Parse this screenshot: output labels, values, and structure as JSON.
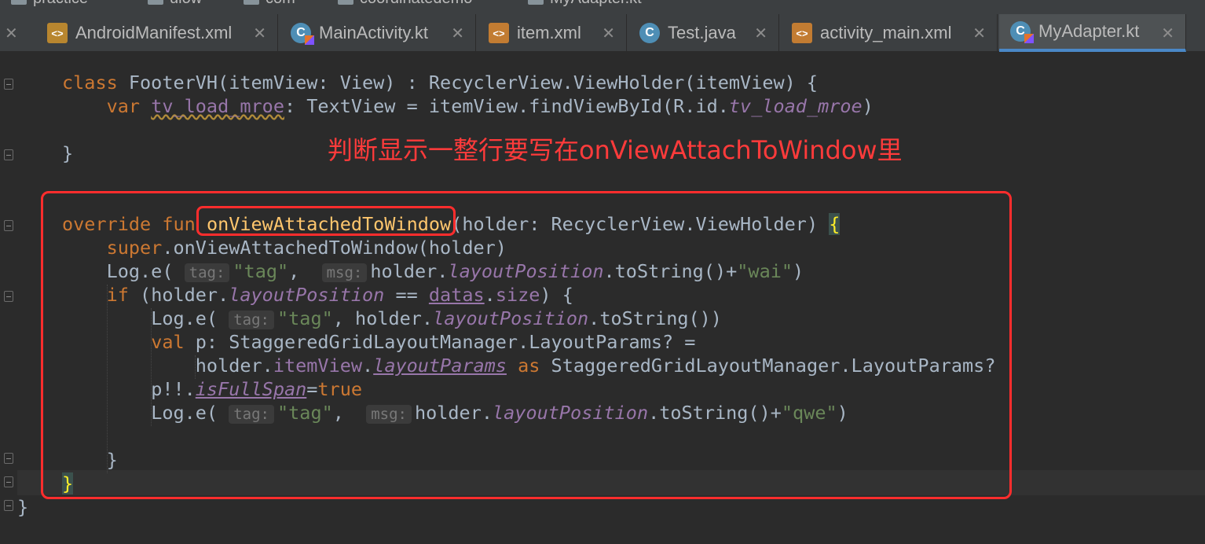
{
  "breadcrumbs": [
    "practice",
    "ulow",
    "com",
    "coordinatedemo",
    "MyAdapter.kt"
  ],
  "tabs": [
    {
      "label": "AndroidManifest.xml",
      "icon": "xml-manifest-icon"
    },
    {
      "label": "MainActivity.kt",
      "icon": "kotlin-class-icon"
    },
    {
      "label": "item.xml",
      "icon": "xml-layout-icon"
    },
    {
      "label": "Test.java",
      "icon": "java-class-icon"
    },
    {
      "label": "activity_main.xml",
      "icon": "xml-layout-icon"
    },
    {
      "label": "MyAdapter.kt",
      "icon": "kotlin-class-icon",
      "active": true
    }
  ],
  "close_glyph": "✕",
  "annotation": "判断显示一整行要写在onViewAttachToWindow里",
  "code": {
    "l1": {
      "a": "class ",
      "b": "FooterVH(itemView: View) : RecyclerView.ViewHolder(itemView) {"
    },
    "l2": {
      "a": "var ",
      "b": "tv_load_mroe",
      "c": ": TextView = itemView.findViewById(R.id.",
      "d": "tv_load_mroe",
      "e": ")"
    },
    "l3": "}",
    "l4": {
      "a": "override fun ",
      "b": "onViewAttachedToWindow",
      "c": "(holder: RecyclerView.ViewHolder) ",
      "d": "{"
    },
    "l5": {
      "a": "super",
      "b": ".onViewAttachedToWindow(holder)"
    },
    "l6": {
      "a": "Log.e( ",
      "h1": "tag:",
      "s1": "\"tag\"",
      "c": ",  ",
      "h2": "msg:",
      "d": "holder.",
      "p": "layoutPosition",
      "e": ".toString()+",
      "s2": "\"wai\"",
      "f": ")"
    },
    "l7": {
      "a": "if ",
      "b": "(holder.",
      "p": "layoutPosition",
      "c": " == ",
      "u": "datas",
      "d": ".",
      "p2": "size",
      "e": ") {"
    },
    "l8": {
      "a": "Log.e( ",
      "h1": "tag:",
      "s1": "\"tag\"",
      "c": ", holder.",
      "p": "layoutPosition",
      "e": ".toString())"
    },
    "l9": {
      "a": "val ",
      "b": "p: StaggeredGridLayoutManager.LayoutParams? ="
    },
    "l10": {
      "a": "holder.",
      "p": "itemView",
      "b": ".",
      "u": "layoutParams",
      "c": " as ",
      "d": "StaggeredGridLayoutManager.LayoutParams?"
    },
    "l11": {
      "a": "p!!.",
      "u": "isFullSpan",
      "b": "=",
      "c": "true"
    },
    "l12": {
      "a": "Log.e( ",
      "h1": "tag:",
      "s1": "\"tag\"",
      "c": ",  ",
      "h2": "msg:",
      "d": "holder.",
      "p": "layoutPosition",
      "e": ".toString()+",
      "s2": "\"qwe\"",
      "f": ")"
    },
    "l13": "}",
    "l14": "}",
    "l15": "}"
  }
}
